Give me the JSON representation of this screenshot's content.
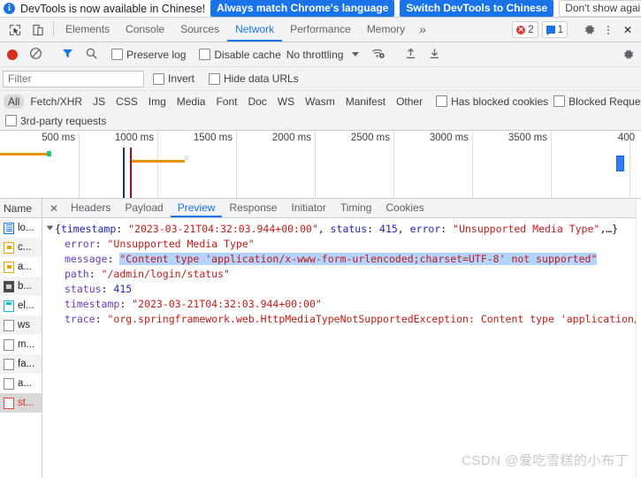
{
  "infobar": {
    "message": "DevTools is now available in Chinese!",
    "primary_button": "Always match Chrome's language",
    "secondary_button": "Switch DevTools to Chinese",
    "dismiss_button": "Don't show again",
    "close_label": "✕",
    "info_glyph": "i",
    "accent_color": "#1a73e8"
  },
  "main_tabs": {
    "items": [
      {
        "label": "Elements",
        "active": false
      },
      {
        "label": "Console",
        "active": false
      },
      {
        "label": "Sources",
        "active": false
      },
      {
        "label": "Network",
        "active": true
      },
      {
        "label": "Performance",
        "active": false
      },
      {
        "label": "Memory",
        "active": false
      }
    ],
    "more_label": "»",
    "error_count": "2",
    "message_count": "1",
    "settings_label": "⚙",
    "kebab_label": "⋮",
    "close_label": "✕"
  },
  "network_toolbar": {
    "record_title": "Stop recording network log",
    "clear_title": "Clear",
    "filter_title": "Filter",
    "search_title": "Search",
    "preserve_log": "Preserve log",
    "disable_cache": "Disable cache",
    "throttling": "No throttling",
    "caret": "▼",
    "wifi_title": "Network conditions",
    "import_title": "Import HAR file",
    "export_title": "Export HAR file",
    "settings_title": "Network settings"
  },
  "filter_row": {
    "placeholder": "Filter",
    "value": "",
    "invert": "Invert",
    "hide_data_urls": "Hide data URLs"
  },
  "type_filters": {
    "items": [
      {
        "label": "All",
        "active": true
      },
      {
        "label": "Fetch/XHR",
        "active": false
      },
      {
        "label": "JS",
        "active": false
      },
      {
        "label": "CSS",
        "active": false
      },
      {
        "label": "Img",
        "active": false
      },
      {
        "label": "Media",
        "active": false
      },
      {
        "label": "Font",
        "active": false
      },
      {
        "label": "Doc",
        "active": false
      },
      {
        "label": "WS",
        "active": false
      },
      {
        "label": "Wasm",
        "active": false
      },
      {
        "label": "Manifest",
        "active": false
      },
      {
        "label": "Other",
        "active": false
      }
    ],
    "has_blocked_cookies": "Has blocked cookies",
    "blocked_requests": "Blocked Requests",
    "third_party_requests": "3rd-party requests"
  },
  "overview": {
    "ticks": [
      "500 ms",
      "1000 ms",
      "1500 ms",
      "2000 ms",
      "2500 ms",
      "3000 ms",
      "3500 ms",
      "400"
    ],
    "bar_color": "#e59400",
    "marker_blue": "#1a2d8f",
    "marker_red": "#b40a0a"
  },
  "request_list": {
    "header": "Name",
    "rows": [
      {
        "label": "lo...",
        "type": "doc",
        "error": false
      },
      {
        "label": "c...",
        "type": "img",
        "error": false
      },
      {
        "label": "a...",
        "type": "img",
        "error": false
      },
      {
        "label": "b...",
        "type": "media",
        "error": false
      },
      {
        "label": "el...",
        "type": "script",
        "error": false
      },
      {
        "label": "ws",
        "type": "other",
        "error": false
      },
      {
        "label": "m...",
        "type": "other",
        "error": false
      },
      {
        "label": "fa...",
        "type": "other",
        "error": false
      },
      {
        "label": "a...",
        "type": "other",
        "error": false
      },
      {
        "label": "st...",
        "type": "errico",
        "error": true
      }
    ]
  },
  "detail_tabs": {
    "close_label": "✕",
    "items": [
      {
        "label": "Headers",
        "active": false
      },
      {
        "label": "Payload",
        "active": false
      },
      {
        "label": "Preview",
        "active": true
      },
      {
        "label": "Response",
        "active": false
      },
      {
        "label": "Initiator",
        "active": false
      },
      {
        "label": "Timing",
        "active": false
      },
      {
        "label": "Cookies",
        "active": false
      }
    ]
  },
  "preview": {
    "root_summary": {
      "open_brace": "{",
      "k_timestamp": "timestamp",
      "v_timestamp": "\"2023-03-21T04:32:03.944+00:00\"",
      "k_status": "status",
      "v_status": "415",
      "k_error": "error",
      "v_error": "\"Unsupported Media Type\"",
      "ellipsis": ",…}"
    },
    "rows": [
      {
        "key": "error",
        "value": "\"Unsupported Media Type\"",
        "kind": "string",
        "highlight": false
      },
      {
        "key": "message",
        "value": "\"Content type 'application/x-www-form-urlencoded;charset=UTF-8' not supported\"",
        "kind": "string",
        "highlight": true
      },
      {
        "key": "path",
        "value": "\"/admin/login/status\"",
        "kind": "string",
        "highlight": false
      },
      {
        "key": "status",
        "value": "415",
        "kind": "number",
        "highlight": false
      },
      {
        "key": "timestamp",
        "value": "\"2023-03-21T04:32:03.944+00:00\"",
        "kind": "string",
        "highlight": false
      },
      {
        "key": "trace",
        "value": "\"org.springframework.web.HttpMediaTypeNotSupportedException: Content type 'application/x-w",
        "kind": "string",
        "highlight": false
      }
    ]
  },
  "watermark": "CSDN @爱吃雪糕的小布丁"
}
